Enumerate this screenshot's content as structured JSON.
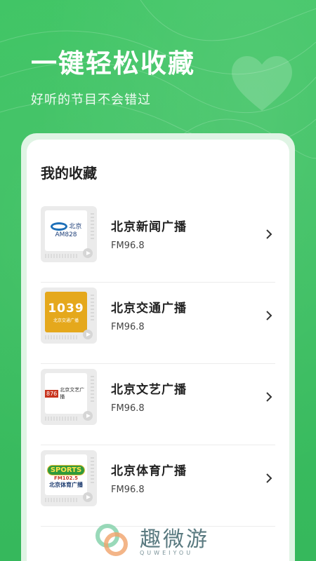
{
  "hero": {
    "title": "一键轻松收藏",
    "subtitle": "好听的节目不会错过"
  },
  "card": {
    "title": "我的收藏",
    "items": [
      {
        "name": "北京新闻广播",
        "freq": "FM96.8",
        "logo": {
          "line1": "北京",
          "line2": "AM828"
        }
      },
      {
        "name": "北京交通广播",
        "freq": "FM96.8",
        "logo": {
          "big": "1039",
          "small": "北京交通广播"
        }
      },
      {
        "name": "北京文艺广播",
        "freq": "FM96.8",
        "logo": {
          "badge": "876",
          "text": "北京文艺广播"
        }
      },
      {
        "name": "北京体育广播",
        "freq": "FM96.8",
        "logo": {
          "sports": "SPORTS",
          "fm": "FM102.5",
          "cn": "北京体育广播"
        }
      }
    ]
  },
  "watermark": {
    "brand": "趣微游",
    "sub": "QUWEIYOU"
  },
  "colors": {
    "background": "#3bbf62",
    "accent_green": "#2f9a3c"
  }
}
